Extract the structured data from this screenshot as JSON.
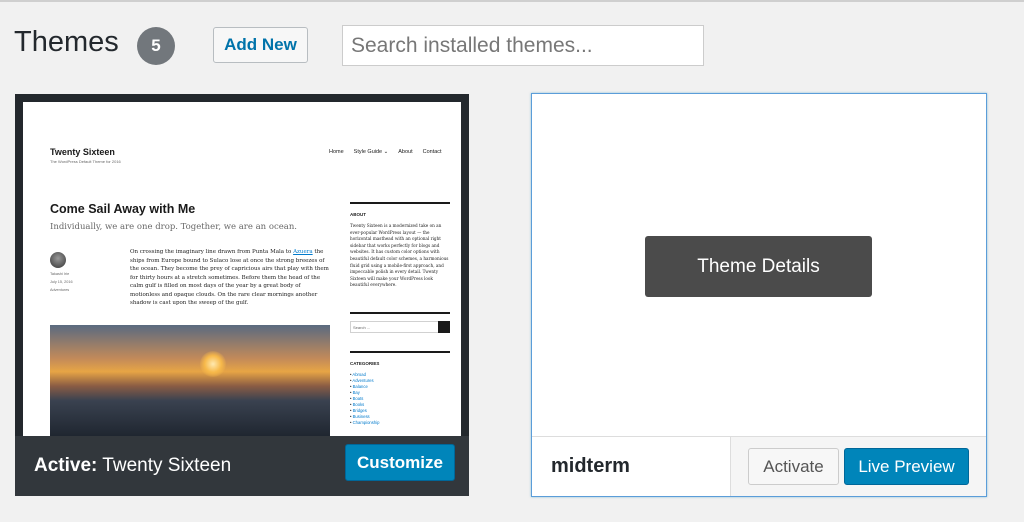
{
  "header": {
    "title": "Themes",
    "count": "5",
    "add_new_label": "Add New",
    "search_placeholder": "Search installed themes..."
  },
  "active_theme": {
    "prefix": "Active:",
    "name": "Twenty Sixteen",
    "customize_label": "Customize",
    "screenshot": {
      "site_title": "Twenty Sixteen",
      "tagline": "The WordPress Default Theme for 2016",
      "nav": [
        "Home",
        "Style Guide ⌄",
        "About",
        "Contact"
      ],
      "post_title": "Come Sail Away with Me",
      "excerpt": "Individually, we are one drop. Together, we are an ocean.",
      "author": "Takashi Irie",
      "date": "July 15, 2016",
      "category": "Adventures",
      "body_before_link": "On crossing the imaginary line drawn from Punta Mala to ",
      "body_link": "Azuera",
      "body_after_link": " the ships from Europe bound to Sulaco lose at once the strong breezes of the ocean. They become the prey of capricious airs that play with them for thirty hours at a stretch sometimes. Before them the head of the calm gulf is filled on most days of the year by a great body of motionless and opaque clouds. On the rare clear mornings another shadow is cast upon the sweep of the gulf.",
      "about_heading": "ABOUT",
      "about_text": "Twenty Sixteen is a modernized take on an ever-popular WordPress layout — the horizontal masthead with an optional right sidebar that works perfectly for blogs and websites. It has custom color options with beautiful default color schemes, a harmonious fluid grid using a mobile-first approach, and impeccable polish in every detail. Twenty Sixteen will make your WordPress look beautiful everywhere.",
      "search_placeholder": "Search ...",
      "categories_heading": "CATEGORIES",
      "categories": [
        "Abroad",
        "Adventures",
        "Balance",
        "Bay",
        "Boats",
        "Books",
        "Bridges",
        "Business",
        "Championship"
      ]
    }
  },
  "other_theme": {
    "name": "midterm",
    "details_label": "Theme Details",
    "activate_label": "Activate",
    "live_preview_label": "Live Preview"
  },
  "colors": {
    "primary": "#0085ba",
    "active_card": "#23282d",
    "active_bar": "#32373c",
    "link": "#0073aa"
  }
}
